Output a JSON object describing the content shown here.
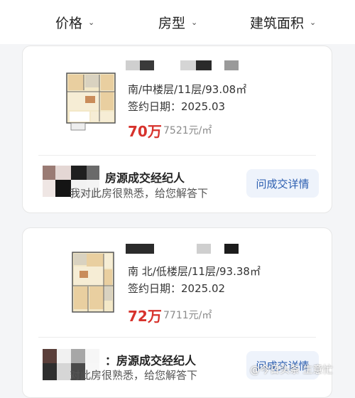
{
  "filters": {
    "price": "价格",
    "layout": "房型",
    "area": "建筑面积",
    "caret": "⌄"
  },
  "listings": [
    {
      "meta": "南/中楼层/11层/93.08㎡",
      "sign_date": "签约日期：2025.03",
      "price": "70万",
      "unit_price": "7521元/㎡",
      "agent_title": "房源成交经纪人",
      "agent_desc": "我对此房很熟悉，给您解答下",
      "detail_button": "问成交详情"
    },
    {
      "meta": "南 北/低楼层/11层/93.38㎡",
      "sign_date": "签约日期：2025.02",
      "price": "72万",
      "unit_price": "7711元/㎡",
      "agent_title": "：房源成交经纪人",
      "agent_desc": "对此房很熟悉，给您解答下",
      "detail_button": "问成交详情"
    }
  ],
  "watermark": "@今日头条 生意忙",
  "colors": {
    "price_red": "#d7322c",
    "button_blue": "#2a5db0",
    "button_bg": "#eef3fb"
  }
}
